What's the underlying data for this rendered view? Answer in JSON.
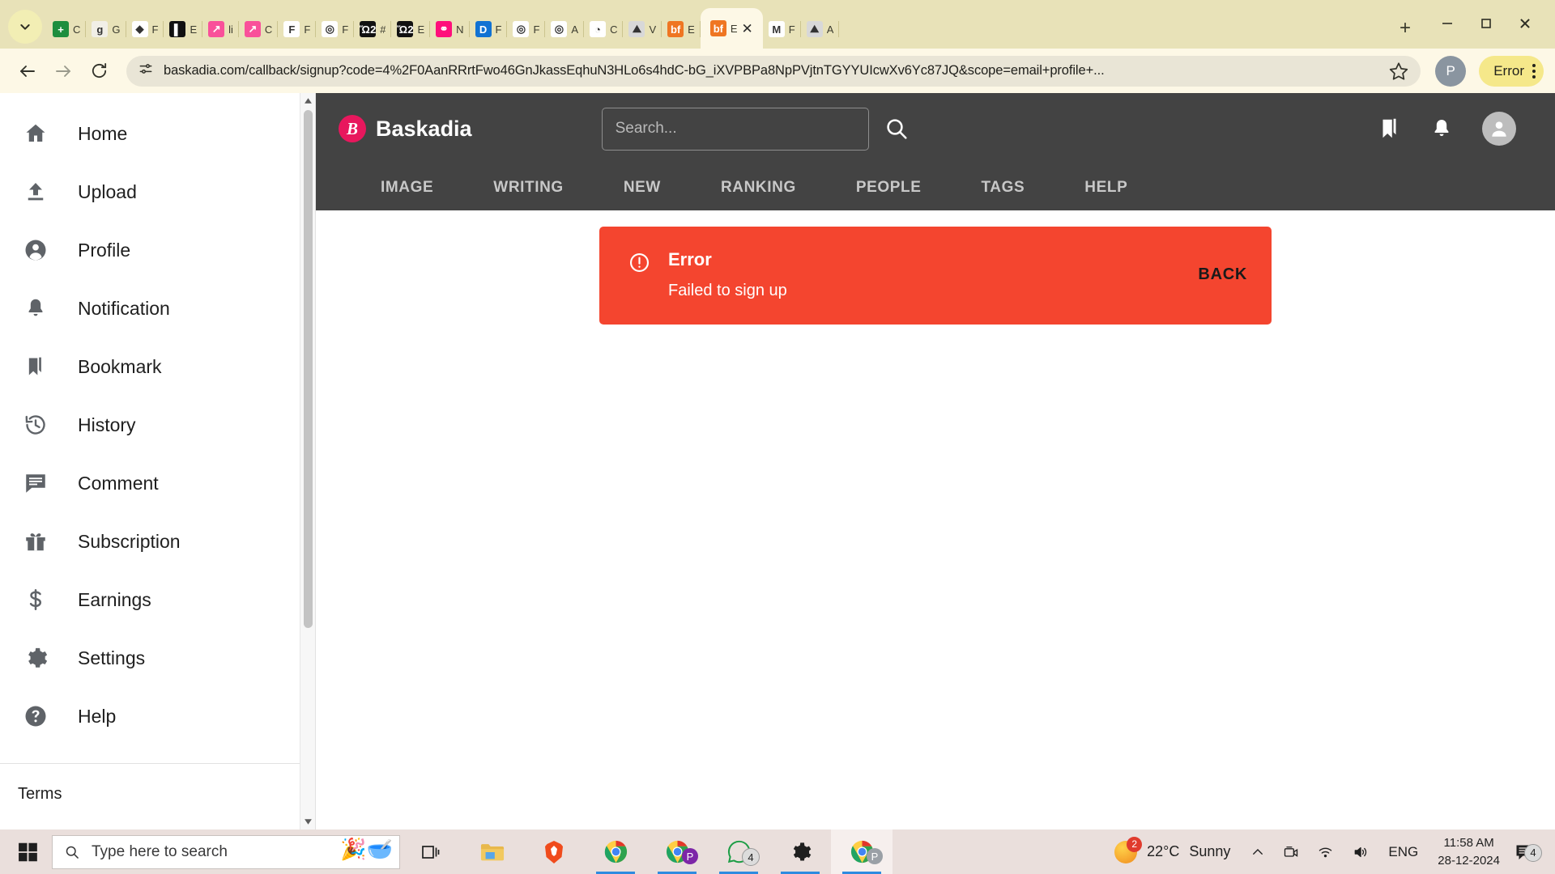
{
  "browser": {
    "tabs": [
      {
        "title": "C",
        "icon": "sheets-icon",
        "color": "#1e8e3e",
        "glyph": "+",
        "active": false
      },
      {
        "title": "G",
        "icon": "google-icon",
        "color": "#f1efe7",
        "glyph": "g",
        "active": false
      },
      {
        "title": "F",
        "icon": "figma-icon",
        "color": "#ffffff",
        "glyph": "◆",
        "active": false
      },
      {
        "title": "E",
        "icon": "book-icon",
        "color": "#111111",
        "glyph": "▌",
        "active": false
      },
      {
        "title": "li",
        "icon": "chart-pink-icon",
        "color": "#f9519a",
        "glyph": "↗",
        "active": false
      },
      {
        "title": "C",
        "icon": "chart-pink-icon",
        "color": "#f9519a",
        "glyph": "↗",
        "active": false
      },
      {
        "title": "F",
        "icon": "f-red-icon",
        "color": "#ffffff",
        "glyph": "F",
        "active": false
      },
      {
        "title": "F",
        "icon": "blue-ring-icon",
        "color": "#ffffff",
        "glyph": "◎",
        "active": false
      },
      {
        "title": "#",
        "icon": "cart-icon",
        "color": "#111111",
        "glyph": "Ὥ2",
        "active": false
      },
      {
        "title": "E",
        "icon": "cart-icon",
        "color": "#111111",
        "glyph": "Ὥ2",
        "active": false
      },
      {
        "title": "N",
        "icon": "link-pink-icon",
        "color": "#ff0f7b",
        "glyph": "⚭",
        "active": false
      },
      {
        "title": "F",
        "icon": "dribbble-icon",
        "color": "#1172d3",
        "glyph": "D",
        "active": false
      },
      {
        "title": "F",
        "icon": "ring-yellow-icon",
        "color": "#ffffff",
        "glyph": "◎",
        "active": false
      },
      {
        "title": "A",
        "icon": "ring-yellow-icon",
        "color": "#ffffff",
        "glyph": "◎",
        "active": false
      },
      {
        "title": "C",
        "icon": "orange-swirl-icon",
        "color": "#ffffff",
        "glyph": "◔",
        "active": false
      },
      {
        "title": "V",
        "icon": "image-icon",
        "color": "#d8d8d8",
        "glyph": "⛰",
        "active": false
      },
      {
        "title": "E",
        "icon": "bf-orange-icon",
        "color": "#ef7622",
        "glyph": "bf",
        "active": false
      },
      {
        "title": "E",
        "icon": "bf-orange-icon",
        "color": "#ef7622",
        "glyph": "bf",
        "active": true
      },
      {
        "title": "F",
        "icon": "gmail-icon",
        "color": "#ffffff",
        "glyph": "M",
        "active": false
      },
      {
        "title": "A",
        "icon": "image-icon",
        "color": "#d8d8d8",
        "glyph": "⛰",
        "active": false
      }
    ],
    "new_tab_label": "+",
    "close_label": "✕",
    "window_controls": {
      "minimize": "─",
      "maximize": "□",
      "close": "✕"
    },
    "url": "baskadia.com/callback/signup?code=4%2F0AanRRrtFwo46GnJkassEqhuN3HLo6s4hdC-bG_iXVPBPa8NpPVjtnTGYYUIcwXv6Yc87JQ&scope=email+profile+...",
    "profile_initial": "P",
    "error_button_label": "Error",
    "back_label": "back",
    "forward_label": "forward",
    "reload_label": "reload"
  },
  "sidebar": {
    "items": [
      {
        "label": "Home",
        "icon": "home-icon"
      },
      {
        "label": "Upload",
        "icon": "upload-icon"
      },
      {
        "label": "Profile",
        "icon": "person-circle-icon"
      },
      {
        "label": "Notification",
        "icon": "bell-icon"
      },
      {
        "label": "Bookmark",
        "icon": "bookmark-icon"
      },
      {
        "label": "History",
        "icon": "history-icon"
      },
      {
        "label": "Comment",
        "icon": "comment-icon"
      },
      {
        "label": "Subscription",
        "icon": "gift-icon"
      },
      {
        "label": "Earnings",
        "icon": "dollar-icon"
      },
      {
        "label": "Settings",
        "icon": "gear-icon"
      },
      {
        "label": "Help",
        "icon": "help-circle-icon"
      }
    ],
    "footer": {
      "terms": "Terms"
    }
  },
  "app": {
    "brand": {
      "name": "Baskadia",
      "mark": "B",
      "color": "#e8175d"
    },
    "search": {
      "placeholder": "Search...",
      "value": ""
    },
    "header_icons": [
      "bookmark-icon",
      "bell-icon",
      "avatar"
    ],
    "nav": [
      {
        "label": "IMAGE"
      },
      {
        "label": "WRITING"
      },
      {
        "label": "NEW"
      },
      {
        "label": "RANKING"
      },
      {
        "label": "PEOPLE"
      },
      {
        "label": "TAGS"
      },
      {
        "label": "HELP"
      }
    ],
    "alert": {
      "title": "Error",
      "message": "Failed to sign up",
      "action": "BACK",
      "color": "#f4452f"
    }
  },
  "taskbar": {
    "start_label": "Start",
    "search_placeholder": "Type here to search",
    "items": [
      {
        "name": "task-view",
        "glyph": "⌶"
      },
      {
        "name": "file-explorer",
        "glyph": "folder"
      },
      {
        "name": "brave-browser",
        "glyph": "brave"
      },
      {
        "name": "chrome-browser",
        "glyph": "chrome"
      },
      {
        "name": "chrome-profile",
        "glyph": "chrome-p",
        "badge": ""
      },
      {
        "name": "whatsapp",
        "glyph": "whatsapp",
        "badge": "4"
      },
      {
        "name": "settings",
        "glyph": "gear"
      },
      {
        "name": "chrome-active",
        "glyph": "chrome-p"
      }
    ],
    "weather": {
      "temperature": "22°C",
      "condition": "Sunny",
      "badge": "2"
    },
    "language": "ENG",
    "time": "11:58 AM",
    "date": "28-12-2024",
    "notification_count": "4"
  }
}
